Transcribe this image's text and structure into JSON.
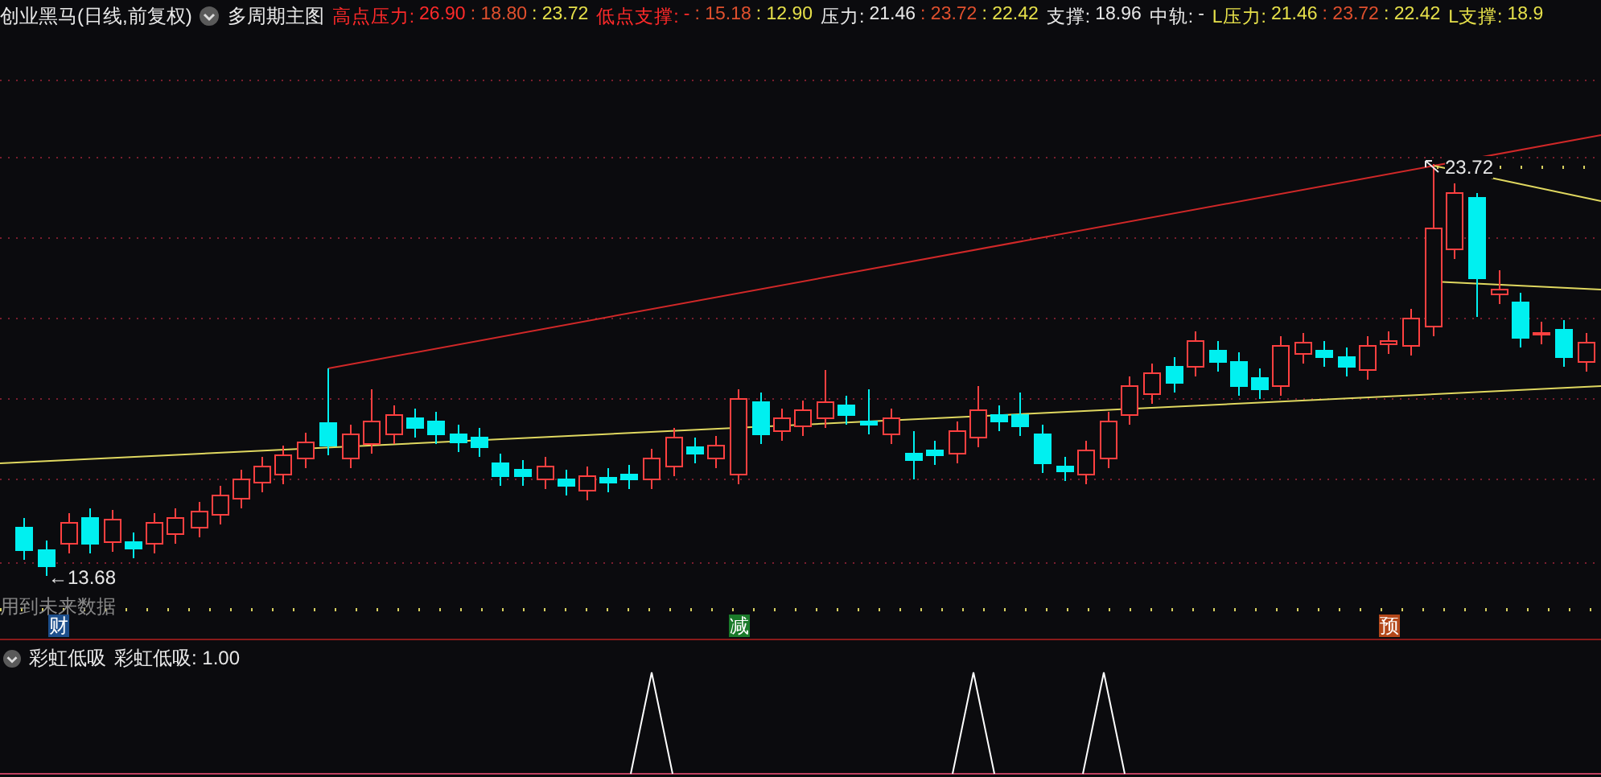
{
  "header": {
    "title": "创业黑马(日线,前复权)",
    "chart_mode": "多周期主图"
  },
  "indicators": [
    {
      "label": {
        "text": "高点压力:",
        "color": "#ff2a2a"
      },
      "values": [
        {
          "text": "26.90",
          "color": "#ff2a2a"
        },
        {
          "text": ": 18.80",
          "color": "#e0502e"
        },
        {
          "text": ": 23.72",
          "color": "#e6e04a"
        }
      ]
    },
    {
      "label": {
        "text": "低点支撑:",
        "color": "#ff2a2a"
      },
      "values": [
        {
          "text": "-",
          "color": "#ff2a2a"
        },
        {
          "text": ": 15.18",
          "color": "#e0502e"
        },
        {
          "text": ": 12.90",
          "color": "#e6e04a"
        }
      ]
    },
    {
      "label": {
        "text": "压力:",
        "color": "#e8e8e8"
      },
      "values": [
        {
          "text": "21.46",
          "color": "#e8e8e8"
        },
        {
          "text": ": 23.72",
          "color": "#e0502e"
        },
        {
          "text": ": 22.42",
          "color": "#e6e04a"
        }
      ]
    },
    {
      "label": {
        "text": "支撑:",
        "color": "#e8e8e8"
      },
      "values": [
        {
          "text": "18.96",
          "color": "#e8e8e8"
        }
      ]
    },
    {
      "label": {
        "text": "中轨:",
        "color": "#e8e8e8"
      },
      "values": [
        {
          "text": "-",
          "color": "#e8e8e8"
        }
      ]
    },
    {
      "label": {
        "text": "L压力:",
        "color": "#e6e04a"
      },
      "values": [
        {
          "text": "21.46",
          "color": "#e6e04a"
        },
        {
          "text": ": 23.72",
          "color": "#e0502e"
        },
        {
          "text": ": 22.42",
          "color": "#e6e04a"
        }
      ]
    },
    {
      "label": {
        "text": "L支撑:",
        "color": "#e6e04a"
      },
      "values": [
        {
          "text": "18.9",
          "color": "#e6e04a"
        }
      ]
    }
  ],
  "price_labels": [
    "←13.68",
    "23.72"
  ],
  "notice": "用到未来数据",
  "events": [
    {
      "text": "财",
      "color": "#1d4f8c"
    },
    {
      "text": "减",
      "color": "#1a7a2a"
    },
    {
      "text": "预",
      "color": "#b4481a"
    }
  ],
  "sub_pane": {
    "name": "彩虹低吸",
    "reading": "彩虹低吸: 1.00"
  }
}
